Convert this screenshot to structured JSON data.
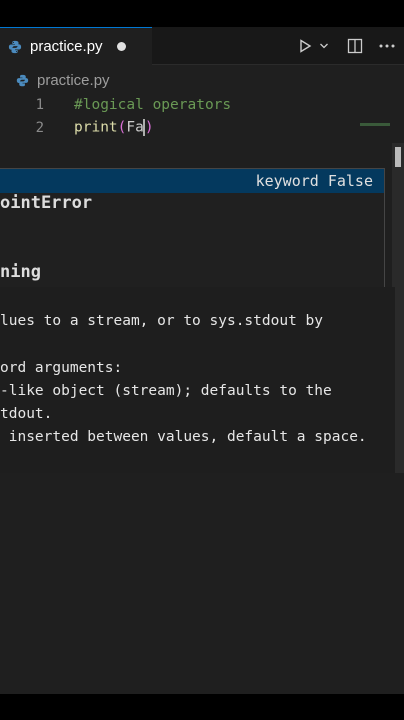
{
  "tab": {
    "filename": "practice.py"
  },
  "breadcrumb": {
    "filename": "practice.py"
  },
  "editor": {
    "lines": [
      {
        "number": "1",
        "comment": "#logical operators"
      },
      {
        "number": "2",
        "fn": "print",
        "open": "(",
        "arg": "Fa",
        "close": ")"
      }
    ]
  },
  "suggest": {
    "detail": "keyword False",
    "items": [
      "ointError",
      "ning"
    ]
  },
  "doc": {
    "lines": [
      "lues to a stream, or to sys.stdout by",
      "ord arguments:",
      "-like object (stream); defaults to the",
      "tdout.",
      " inserted between values, default a space."
    ]
  }
}
